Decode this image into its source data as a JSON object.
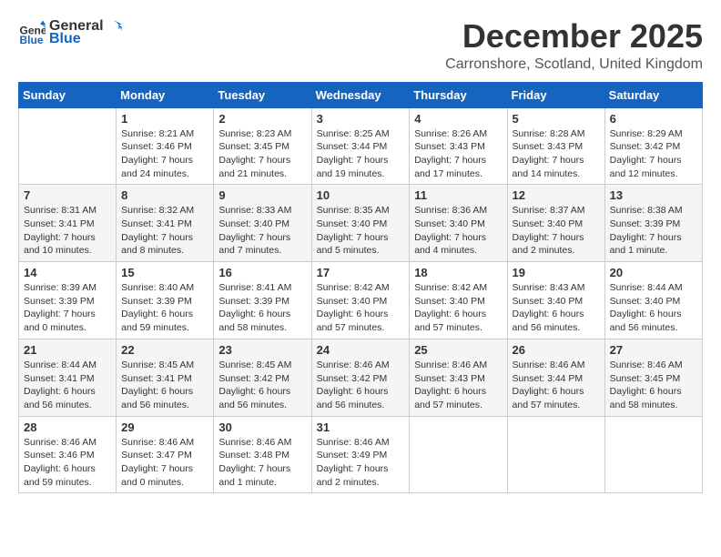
{
  "logo": {
    "general": "General",
    "blue": "Blue"
  },
  "title": "December 2025",
  "location": "Carronshore, Scotland, United Kingdom",
  "days_of_week": [
    "Sunday",
    "Monday",
    "Tuesday",
    "Wednesday",
    "Thursday",
    "Friday",
    "Saturday"
  ],
  "weeks": [
    [
      {
        "day": "",
        "content": ""
      },
      {
        "day": "1",
        "content": "Sunrise: 8:21 AM\nSunset: 3:46 PM\nDaylight: 7 hours\nand 24 minutes."
      },
      {
        "day": "2",
        "content": "Sunrise: 8:23 AM\nSunset: 3:45 PM\nDaylight: 7 hours\nand 21 minutes."
      },
      {
        "day": "3",
        "content": "Sunrise: 8:25 AM\nSunset: 3:44 PM\nDaylight: 7 hours\nand 19 minutes."
      },
      {
        "day": "4",
        "content": "Sunrise: 8:26 AM\nSunset: 3:43 PM\nDaylight: 7 hours\nand 17 minutes."
      },
      {
        "day": "5",
        "content": "Sunrise: 8:28 AM\nSunset: 3:43 PM\nDaylight: 7 hours\nand 14 minutes."
      },
      {
        "day": "6",
        "content": "Sunrise: 8:29 AM\nSunset: 3:42 PM\nDaylight: 7 hours\nand 12 minutes."
      }
    ],
    [
      {
        "day": "7",
        "content": "Sunrise: 8:31 AM\nSunset: 3:41 PM\nDaylight: 7 hours\nand 10 minutes."
      },
      {
        "day": "8",
        "content": "Sunrise: 8:32 AM\nSunset: 3:41 PM\nDaylight: 7 hours\nand 8 minutes."
      },
      {
        "day": "9",
        "content": "Sunrise: 8:33 AM\nSunset: 3:40 PM\nDaylight: 7 hours\nand 7 minutes."
      },
      {
        "day": "10",
        "content": "Sunrise: 8:35 AM\nSunset: 3:40 PM\nDaylight: 7 hours\nand 5 minutes."
      },
      {
        "day": "11",
        "content": "Sunrise: 8:36 AM\nSunset: 3:40 PM\nDaylight: 7 hours\nand 4 minutes."
      },
      {
        "day": "12",
        "content": "Sunrise: 8:37 AM\nSunset: 3:40 PM\nDaylight: 7 hours\nand 2 minutes."
      },
      {
        "day": "13",
        "content": "Sunrise: 8:38 AM\nSunset: 3:39 PM\nDaylight: 7 hours\nand 1 minute."
      }
    ],
    [
      {
        "day": "14",
        "content": "Sunrise: 8:39 AM\nSunset: 3:39 PM\nDaylight: 7 hours\nand 0 minutes."
      },
      {
        "day": "15",
        "content": "Sunrise: 8:40 AM\nSunset: 3:39 PM\nDaylight: 6 hours\nand 59 minutes."
      },
      {
        "day": "16",
        "content": "Sunrise: 8:41 AM\nSunset: 3:39 PM\nDaylight: 6 hours\nand 58 minutes."
      },
      {
        "day": "17",
        "content": "Sunrise: 8:42 AM\nSunset: 3:40 PM\nDaylight: 6 hours\nand 57 minutes."
      },
      {
        "day": "18",
        "content": "Sunrise: 8:42 AM\nSunset: 3:40 PM\nDaylight: 6 hours\nand 57 minutes."
      },
      {
        "day": "19",
        "content": "Sunrise: 8:43 AM\nSunset: 3:40 PM\nDaylight: 6 hours\nand 56 minutes."
      },
      {
        "day": "20",
        "content": "Sunrise: 8:44 AM\nSunset: 3:40 PM\nDaylight: 6 hours\nand 56 minutes."
      }
    ],
    [
      {
        "day": "21",
        "content": "Sunrise: 8:44 AM\nSunset: 3:41 PM\nDaylight: 6 hours\nand 56 minutes."
      },
      {
        "day": "22",
        "content": "Sunrise: 8:45 AM\nSunset: 3:41 PM\nDaylight: 6 hours\nand 56 minutes."
      },
      {
        "day": "23",
        "content": "Sunrise: 8:45 AM\nSunset: 3:42 PM\nDaylight: 6 hours\nand 56 minutes."
      },
      {
        "day": "24",
        "content": "Sunrise: 8:46 AM\nSunset: 3:42 PM\nDaylight: 6 hours\nand 56 minutes."
      },
      {
        "day": "25",
        "content": "Sunrise: 8:46 AM\nSunset: 3:43 PM\nDaylight: 6 hours\nand 57 minutes."
      },
      {
        "day": "26",
        "content": "Sunrise: 8:46 AM\nSunset: 3:44 PM\nDaylight: 6 hours\nand 57 minutes."
      },
      {
        "day": "27",
        "content": "Sunrise: 8:46 AM\nSunset: 3:45 PM\nDaylight: 6 hours\nand 58 minutes."
      }
    ],
    [
      {
        "day": "28",
        "content": "Sunrise: 8:46 AM\nSunset: 3:46 PM\nDaylight: 6 hours\nand 59 minutes."
      },
      {
        "day": "29",
        "content": "Sunrise: 8:46 AM\nSunset: 3:47 PM\nDaylight: 7 hours\nand 0 minutes."
      },
      {
        "day": "30",
        "content": "Sunrise: 8:46 AM\nSunset: 3:48 PM\nDaylight: 7 hours\nand 1 minute."
      },
      {
        "day": "31",
        "content": "Sunrise: 8:46 AM\nSunset: 3:49 PM\nDaylight: 7 hours\nand 2 minutes."
      },
      {
        "day": "",
        "content": ""
      },
      {
        "day": "",
        "content": ""
      },
      {
        "day": "",
        "content": ""
      }
    ]
  ]
}
